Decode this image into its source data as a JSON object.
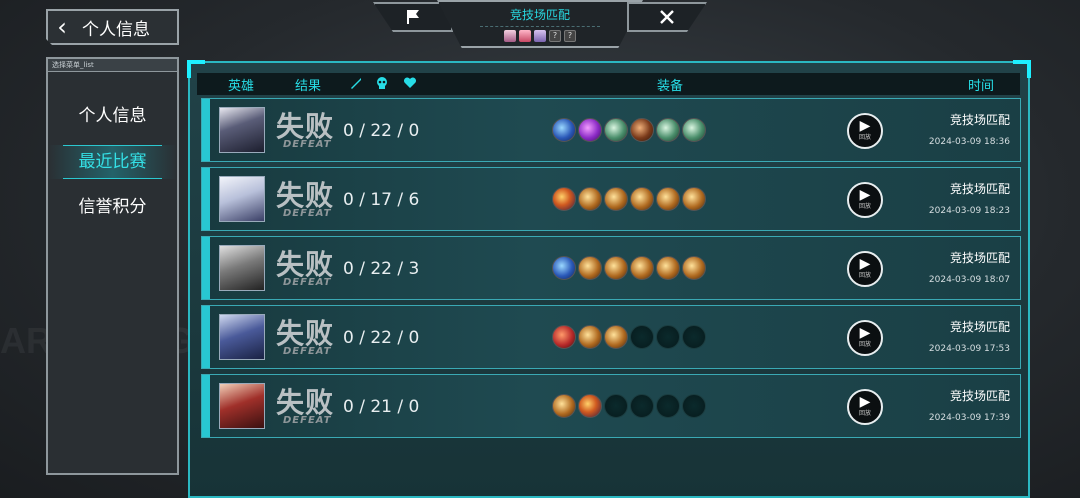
{
  "nav": {
    "back_label": "个人信息"
  },
  "top": {
    "mode_title": "竞技场匹配",
    "hero_unknown": "?"
  },
  "menu": {
    "tag": "选择菜单_list",
    "items": [
      "个人信息",
      "最近比赛",
      "信誉积分"
    ],
    "active_index": 1
  },
  "table": {
    "headers": {
      "hero": "英雄",
      "result": "结果",
      "equipment": "装备",
      "time": "时间"
    },
    "result_main": "失败",
    "result_sub": "DEFEAT",
    "replay_label": "回放",
    "rows": [
      {
        "kda": "0 / 22 / 0",
        "mode": "竞技场匹配",
        "time": "2024-03-09 18:36",
        "items": [
          "blue",
          "purple",
          "green",
          "brown",
          "green",
          "green"
        ]
      },
      {
        "kda": "0 / 17 / 6",
        "mode": "竞技场匹配",
        "time": "2024-03-09 18:23",
        "items": [
          "fire",
          "gold",
          "gold",
          "gold",
          "gold",
          "gold"
        ]
      },
      {
        "kda": "0 / 22 / 3",
        "mode": "竞技场匹配",
        "time": "2024-03-09 18:07",
        "items": [
          "blue",
          "gold",
          "gold",
          "gold",
          "gold",
          "gold"
        ]
      },
      {
        "kda": "0 / 22 / 0",
        "mode": "竞技场匹配",
        "time": "2024-03-09 17:53",
        "items": [
          "red",
          "gold",
          "gold",
          "empty",
          "empty",
          "empty"
        ]
      },
      {
        "kda": "0 / 21 / 0",
        "mode": "竞技场匹配",
        "time": "2024-03-09 17:39",
        "items": [
          "gold",
          "fire",
          "empty",
          "empty",
          "empty",
          "empty"
        ]
      }
    ]
  },
  "colors": {
    "accent": "#28d8e0",
    "panel": "#1f4a51",
    "text": "#e8eef0"
  }
}
